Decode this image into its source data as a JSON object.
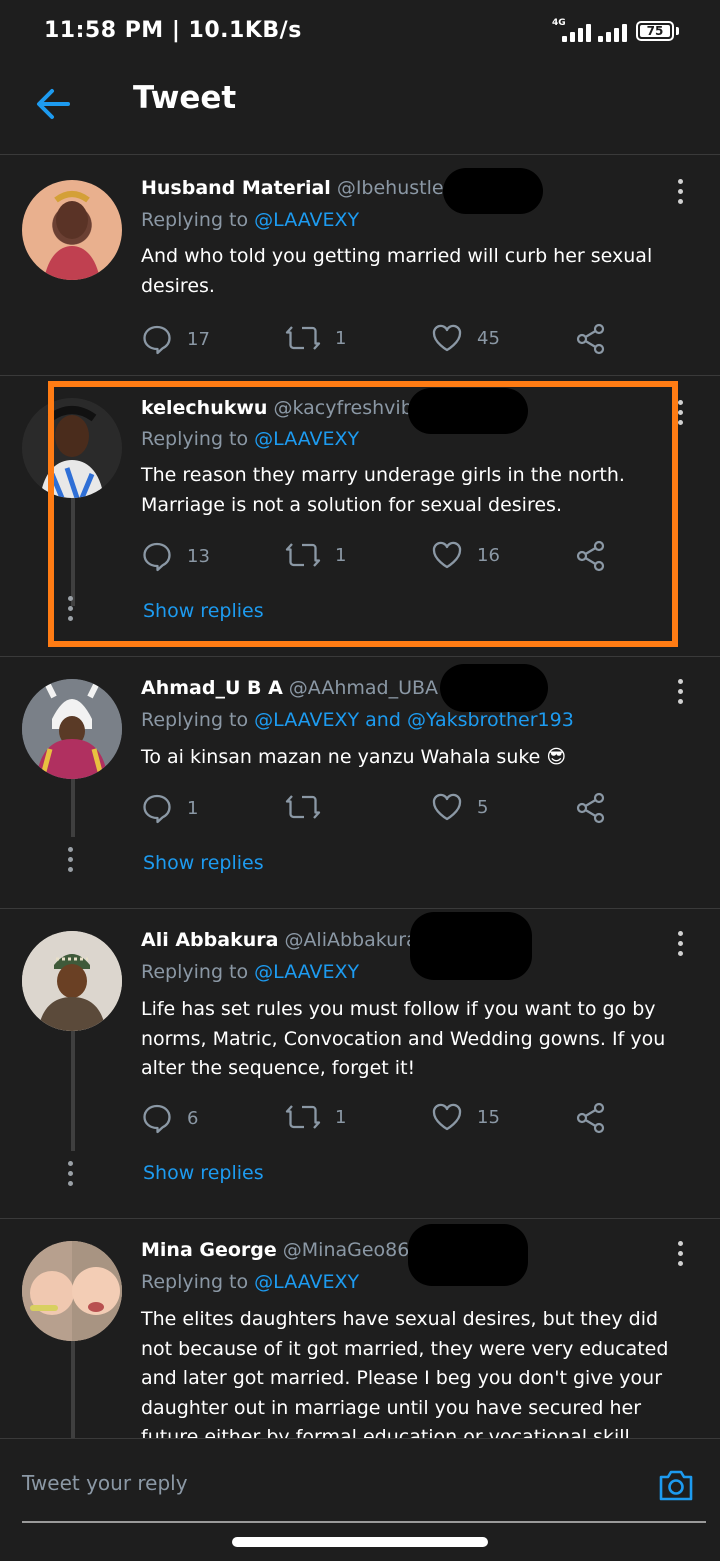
{
  "status_bar": {
    "time": "11:58 PM | 10.1KB/s",
    "network": "4G",
    "battery": "75"
  },
  "header": {
    "title": "Tweet"
  },
  "tweets": [
    {
      "name": "Husband Material",
      "handle": "@Ibehustler",
      "separator": "·",
      "replying_label": "Replying to",
      "replying_to": "@LAAVEXY",
      "text": "And who told you getting married will curb her sexual desires.",
      "replies": "17",
      "retweets": "1",
      "likes": "45"
    },
    {
      "name": "kelechukwu",
      "handle": "@kacyfreshvibes",
      "replying_label": "Replying to",
      "replying_to": "@LAAVEXY",
      "text": "The reason they marry underage girls in the north. Marriage is not a solution for sexual desires.",
      "replies": "13",
      "retweets": "1",
      "likes": "16",
      "show_replies": "Show replies"
    },
    {
      "name": "Ahmad_U B A",
      "handle": "@AAhmad_UBA",
      "replying_label": "Replying to",
      "replying_to": "@LAAVEXY and @Yaksbrother193",
      "text": "To ai kinsan mazan ne yanzu Wahala suke 😎",
      "replies": "1",
      "retweets": "",
      "likes": "5",
      "show_replies": "Show replies"
    },
    {
      "name": "Ali Abbakura",
      "handle": "@AliAbbakura",
      "separator": "·",
      "replying_label": "Replying to",
      "replying_to": "@LAAVEXY",
      "text": "Life has set rules you must follow if you want to go by norms, Matric, Convocation and Wedding gowns. If you alter the sequence, forget it!",
      "replies": "6",
      "retweets": "1",
      "likes": "15",
      "show_replies": "Show replies"
    },
    {
      "name": "Mina George",
      "handle": "@MinaGeo86",
      "separator": "·",
      "replying_label": "Replying to",
      "replying_to": "@LAAVEXY",
      "text": "The elites daughters have sexual desires, but they did not because of it got married, they were very educated and later got married. Please I beg you don't give your daughter out in marriage until you have secured her future either by formal education or vocational skill"
    }
  ],
  "reply_bar": {
    "placeholder": "Tweet your reply"
  },
  "colors": {
    "background": "#1e1e1e",
    "link": "#1d9bf0",
    "muted": "#8b98a5",
    "highlight": "#ff7c14"
  }
}
